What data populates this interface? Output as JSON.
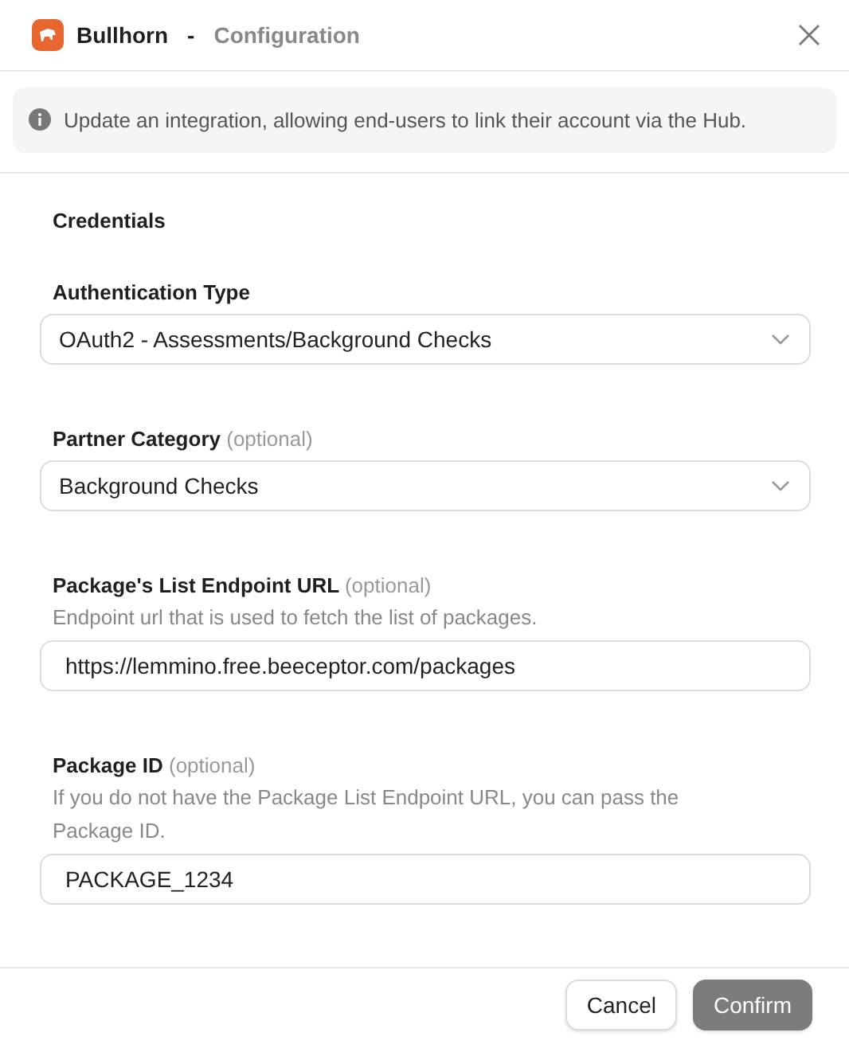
{
  "header": {
    "app_name": "Bullhorn",
    "separator": "-",
    "title": "Configuration"
  },
  "info": "Update an integration, allowing end-users to link their account via the Hub.",
  "section": "Credentials",
  "fields": [
    {
      "kind": "select",
      "label": "Authentication Type",
      "value": "OAuth2 - Assessments/Background Checks"
    },
    {
      "kind": "select",
      "label": "Partner Category",
      "note": "(optional)",
      "value": "Background Checks"
    },
    {
      "kind": "text",
      "label": "Package's List Endpoint URL",
      "note": "(optional)",
      "hint": "Endpoint url that is used to fetch the list of packages.",
      "value": "https://lemmino.free.beeceptor.com/packages"
    },
    {
      "kind": "text",
      "label": "Package ID",
      "note": "(optional)",
      "hint": "If you do not have the Package List Endpoint URL, you can pass the Package ID.",
      "value": "PACKAGE_1234"
    }
  ],
  "buttons": [
    {
      "kind": "secondary",
      "label": "Cancel"
    },
    {
      "kind": "primary",
      "label": "Confirm"
    }
  ]
}
